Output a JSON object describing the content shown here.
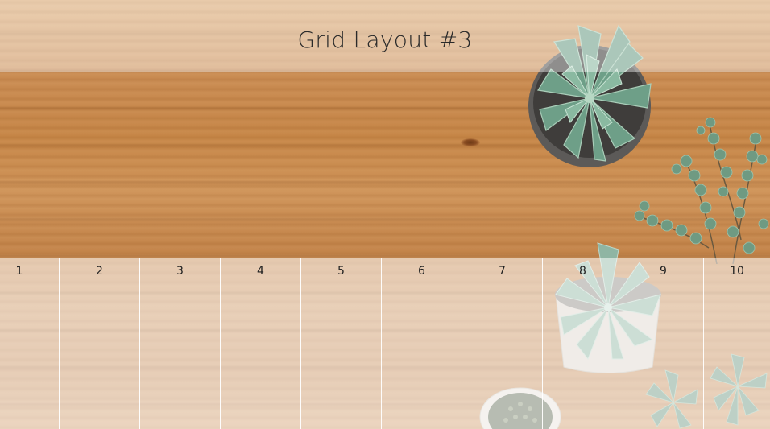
{
  "header": {
    "title": "Grid Layout #3"
  },
  "grid": {
    "cells": [
      {
        "label": "1"
      },
      {
        "label": "2"
      },
      {
        "label": "3"
      },
      {
        "label": "4"
      },
      {
        "label": "5"
      },
      {
        "label": "6"
      },
      {
        "label": "7"
      },
      {
        "label": "8"
      },
      {
        "label": "9"
      },
      {
        "label": "10"
      }
    ]
  },
  "colors": {
    "wood": "#c98b52",
    "overlay": "#ffffff",
    "text": "#222222",
    "plant_green": "#6f9a82"
  }
}
